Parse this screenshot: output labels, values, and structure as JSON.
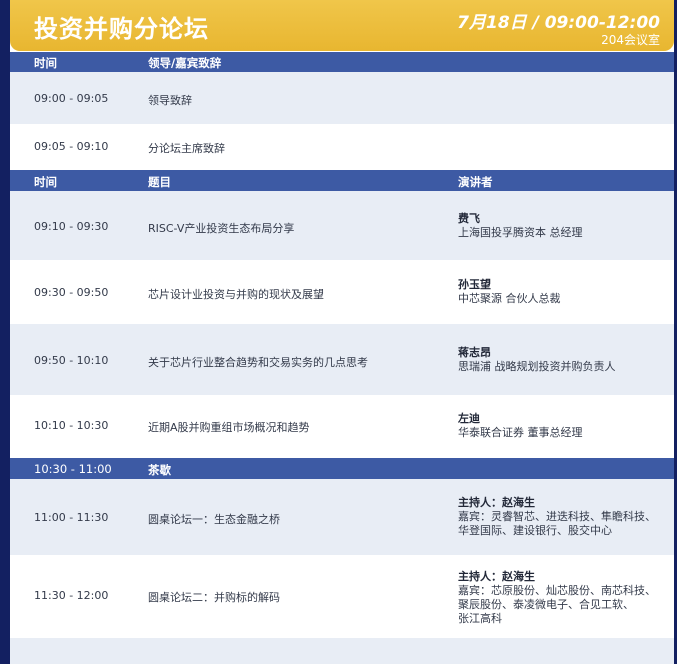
{
  "header": {
    "title": "投资并购分论坛",
    "datetime": "7月18日 / 09:00-12:00",
    "room": "204会议室"
  },
  "section1": {
    "col_time": "时间",
    "col_topic": "领导/嘉宾致辞"
  },
  "rows1": [
    {
      "time": "09:00 - 09:05",
      "topic": "领导致辞"
    },
    {
      "time": "09:05 - 09:10",
      "topic": "分论坛主席致辞"
    }
  ],
  "section2": {
    "col_time": "时间",
    "col_topic": "题目",
    "col_speaker": "演讲者"
  },
  "rows2": [
    {
      "time": "09:10 - 09:30",
      "topic": "RISC-V产业投资生态布局分享",
      "speaker_name": "费飞",
      "speaker_title": "上海国投孚腾资本 总经理"
    },
    {
      "time": "09:30 - 09:50",
      "topic": "芯片设计业投资与并购的现状及展望",
      "speaker_name": "孙玉望",
      "speaker_title": "中芯聚源 合伙人总裁"
    },
    {
      "time": "09:50 - 10:10",
      "topic": "关于芯片行业整合趋势和交易实务的几点思考",
      "speaker_name": "蒋志昂",
      "speaker_title": "思瑞浦 战略规划投资并购负责人"
    },
    {
      "time": "10:10 - 10:30",
      "topic": "近期A股并购重组市场概况和趋势",
      "speaker_name": "左迪",
      "speaker_title": "华泰联合证券 董事总经理"
    }
  ],
  "break": {
    "time": "10:30 - 11:00",
    "label": "茶歇"
  },
  "rows3": [
    {
      "time": "11:00 - 11:30",
      "topic": "圆桌论坛一：生态金融之桥",
      "moderator": "主持人：赵海生",
      "guests_line1": "嘉宾：灵睿智芯、进迭科技、隼瞻科技、",
      "guests_line2": "华登国际、建设银行、股交中心"
    },
    {
      "time": "11:30 - 12:00",
      "topic": "圆桌论坛二：并购标的解码",
      "moderator": "主持人：赵海生",
      "guests_line1": "嘉宾：芯原股份、灿芯股份、南芯科技、",
      "guests_line2": "聚辰股份、泰凌微电子、合见工软、",
      "guests_line3": "张江高科"
    }
  ]
}
